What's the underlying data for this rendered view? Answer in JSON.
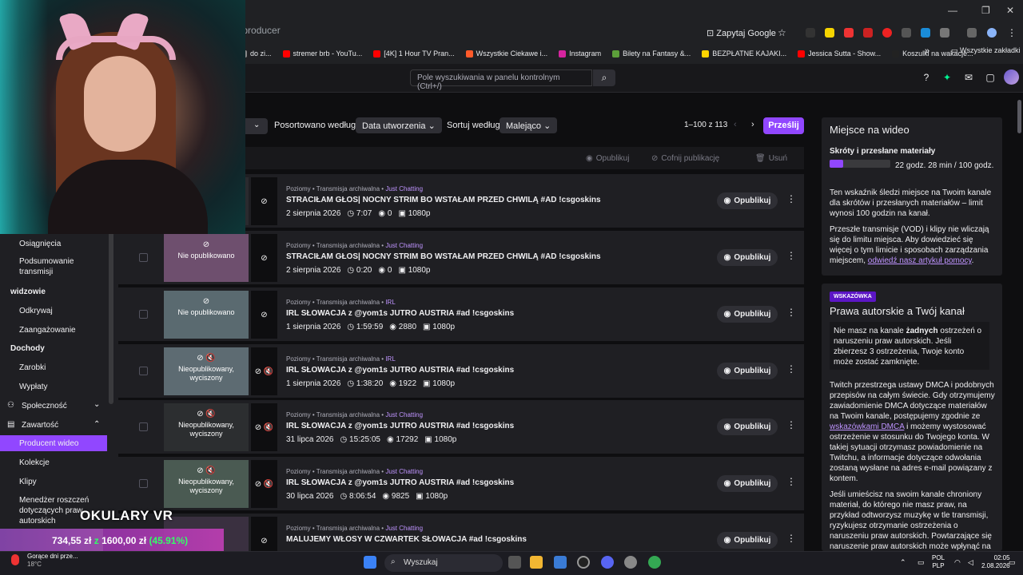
{
  "browser": {
    "address": "eo-producer",
    "google_btn": "Zapytaj Google",
    "bookmarks": [
      {
        "label": "do zi...",
        "color": "#888"
      },
      {
        "label": "stremer brb - YouTu...",
        "color": "#ff0000"
      },
      {
        "label": "[4K] 1 Hour TV Pran...",
        "color": "#ff0000"
      },
      {
        "label": "Wszystkie Ciekawe i...",
        "color": "#ff5a2a"
      },
      {
        "label": "Instagram",
        "color": "#d6249f"
      },
      {
        "label": "Bilety na Fantasy &...",
        "color": "#5c9f3a"
      },
      {
        "label": "BEZPŁATNE KAJAKI...",
        "color": "#ffd400"
      },
      {
        "label": "Jessica Sutta - Show...",
        "color": "#ff0000"
      },
      {
        "label": "Koszulki na wakacje...",
        "color": "#222"
      }
    ],
    "all_bookmarks": "Wszystkie zakładki"
  },
  "header": {
    "search_placeholder": "Pole wyszukiwania w panelu kontrolnym (Ctrl+/)"
  },
  "sidebar": {
    "items": [
      {
        "label": "Osiągnięcia"
      },
      {
        "label": "Podsumowanie transmisji"
      },
      {
        "section": "widzowie"
      },
      {
        "label": "Odkrywaj"
      },
      {
        "label": "Zaangażowanie"
      },
      {
        "section": "Dochody"
      },
      {
        "label": "Zarobki"
      },
      {
        "label": "Wypłaty"
      },
      {
        "label": "Społeczność"
      },
      {
        "label": "Zawartość"
      },
      {
        "label": "Producent wideo"
      },
      {
        "label": "Kolekcje"
      },
      {
        "label": "Klipy"
      },
      {
        "label": "Menedżer roszczeń dotyczących praw autorskich"
      }
    ]
  },
  "toolbar": {
    "sort_label": "Posortowano według:",
    "sort_value": "Data utworzenia",
    "order_label": "Sortuj według",
    "order_value": "Malejąco",
    "pagination": "1–100 z 113",
    "upload": "Prześlij",
    "publish": "Opublikuj",
    "unpublish": "Cofnij publikację",
    "delete": "Usuń"
  },
  "videos": [
    {
      "meta": "Poziomy • Transmisja archiwalna •",
      "category": "Just Chatting",
      "title": "STRACIŁAM GŁOS| NOCNY STRIM BO WSTAŁAM PRZED CHWILĄ #AD !csgoskins",
      "date": "2 sierpnia 2026",
      "duration": "7:07",
      "views": "0",
      "quality": "1080p",
      "thumb_label": "",
      "publish": "Opublikuj"
    },
    {
      "meta": "Poziomy • Transmisja archiwalna •",
      "category": "Just Chatting",
      "title": "STRACIŁAM GŁOS| NOCNY STRIM BO WSTAŁAM PRZED CHWILĄ #AD !csgoskins",
      "date": "2 sierpnia 2026",
      "duration": "0:20",
      "views": "0",
      "quality": "1080p",
      "thumb_label": "Nie opublikowano",
      "publish": "Opublikuj"
    },
    {
      "meta": "Poziomy • Transmisja archiwalna •",
      "category": "IRL",
      "title": "IRL SŁOWACJA z @yom1s JUTRO AUSTRIA #ad !csgoskins",
      "date": "1 sierpnia 2026",
      "duration": "1:59:59",
      "views": "2880",
      "quality": "1080p",
      "thumb_label": "Nie opublikowano",
      "publish": "Opublikuj"
    },
    {
      "meta": "Poziomy • Transmisja archiwalna •",
      "category": "IRL",
      "title": "IRL SŁOWACJA z @yom1s JUTRO AUSTRIA #ad !csgoskins",
      "date": "1 sierpnia 2026",
      "duration": "1:38:20",
      "views": "1922",
      "quality": "1080p",
      "thumb_label": "Nieopublikowany, wyciszony",
      "publish": "Opublikuj"
    },
    {
      "meta": "Poziomy • Transmisja archiwalna •",
      "category": "Just Chatting",
      "title": "IRL SŁOWACJA z @yom1s JUTRO AUSTRIA #ad !csgoskins",
      "date": "31 lipca 2026",
      "duration": "15:25:05",
      "views": "17292",
      "quality": "1080p",
      "thumb_label": "Nieopublikowany, wyciszony",
      "publish": "Opublikuj"
    },
    {
      "meta": "Poziomy • Transmisja archiwalna •",
      "category": "Just Chatting",
      "title": "IRL SŁOWACJA z @yom1s JUTRO AUSTRIA #ad !csgoskins",
      "date": "30 lipca 2026",
      "duration": "8:06:54",
      "views": "9825",
      "quality": "1080p",
      "thumb_label": "Nieopublikowany, wyciszony",
      "publish": "Opublikuj"
    },
    {
      "meta": "Poziomy • Transmisja archiwalna •",
      "category": "Just Chatting",
      "title": "MALUJEMY WŁOSY W CZWARTEK SŁOWACJA #ad !csgoskins",
      "date": "",
      "duration": "",
      "views": "",
      "quality": "",
      "thumb_label": "",
      "publish": "Opublikuj"
    }
  ],
  "storage": {
    "title": "Miejsce na wideo",
    "sub": "Skróty i przesłane materiały",
    "usage": "22 godz. 28 min / 100 godz.",
    "usage_fraction": 0.22,
    "p1": "Ten wskaźnik śledzi miejsce na Twoim kanale dla skrótów i przesłanych materiałów – limit wynosi 100 godzin na kanał.",
    "p2_pre": "Przeszłe transmisje (VOD) i klipy nie wliczają się do limitu miejsca. Aby dowiedzieć się więcej o tym limicie i sposobach zarządzania miejscem,",
    "p2_link": "odwiedź nasz artykuł pomocy",
    "p2_post": "."
  },
  "tip": {
    "badge": "WSKAZÓWKA",
    "title": "Prawa autorskie a Twój kanał",
    "box_pre": "Nie masz na kanale",
    "box_bold": "żadnych",
    "box_post": "ostrzeżeń o naruszeniu praw autorskich. Jeśli zbierzesz 3 ostrzeżenia, Twoje konto może zostać zamknięte.",
    "p1_pre": "Twitch przestrzega ustawy DMCA i podobnych przepisów na całym świecie. Gdy otrzymujemy zawiadomienie DMCA dotyczące materiałów na Twoim kanale, postępujemy zgodnie ze",
    "p1_link": "wskazówkami DMCA",
    "p1_post": "i możemy wystosować ostrzeżenie w stosunku do Twojego konta. W takiej sytuacji otrzymasz powiadomienie na Twitchu, a informacje dotyczące odwołania zostaną wysłane na adres e-mail powiązany z kontem.",
    "p2": "Jeśli umieścisz na swoim kanale chroniony materiał, do którego nie masz praw, na przykład odtworzysz muzykę w tle transmisji, ryzykujesz otrzymanie ostrzeżenia o naruszeniu praw autorskich. Powtarzające się naruszenie praw autorskich może wpłynąć na"
  },
  "overlay": {
    "title": "OKULARY VR",
    "amount": "734,55 zł",
    "of": "z",
    "goal": "1600,00 zł",
    "percent": "(45.91%)",
    "progress_fraction": 0.4591
  },
  "taskbar": {
    "weather_title": "Gorące dni prze...",
    "weather_temp": "18°C",
    "search": "Wyszukaj",
    "lang1": "POL",
    "lang2": "PLP",
    "time": "02:05",
    "date": "2.08.2026"
  }
}
